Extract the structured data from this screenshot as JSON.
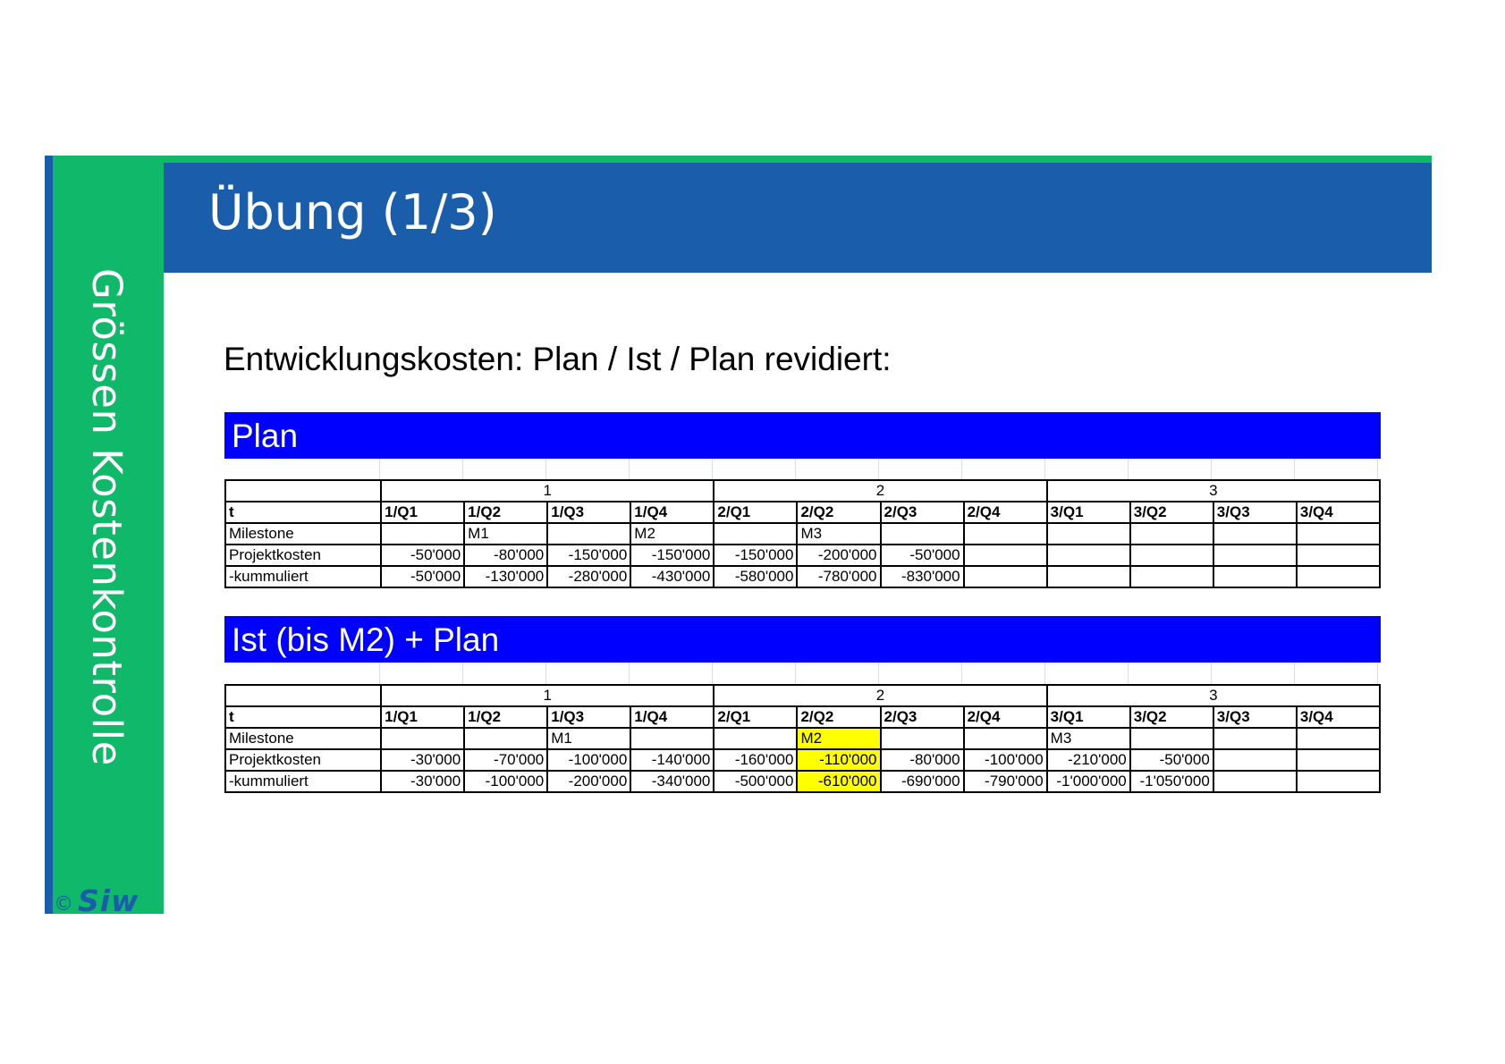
{
  "sidebar": {
    "title": "Grössen Kostenkontrolle",
    "copyright": "©",
    "logo": "Siw"
  },
  "header": {
    "title": "Übung (1/3)"
  },
  "subtitle": "Entwicklungskosten: Plan / Ist / Plan revidiert:",
  "colors": {
    "green": "#10b86a",
    "blue": "#1a5dab",
    "section": "#0000ff",
    "highlight": "#ffff00"
  },
  "tables": [
    {
      "section_label": "Plan",
      "years": [
        "1",
        "2",
        "3"
      ],
      "header": [
        "t",
        "1/Q1",
        "1/Q2",
        "1/Q3",
        "1/Q4",
        "2/Q1",
        "2/Q2",
        "2/Q3",
        "2/Q4",
        "3/Q1",
        "3/Q2",
        "3/Q3",
        "3/Q4"
      ],
      "rows": [
        [
          "Milestone",
          "",
          "M1",
          "",
          "M2",
          "",
          "M3",
          "",
          "",
          "",
          "",
          "",
          ""
        ],
        [
          "Projektkosten",
          "-50'000",
          "-80'000",
          "-150'000",
          "-150'000",
          "-150'000",
          "-200'000",
          "-50'000",
          "",
          "",
          "",
          "",
          ""
        ],
        [
          "-kummuliert",
          "-50'000",
          "-130'000",
          "-280'000",
          "-430'000",
          "-580'000",
          "-780'000",
          "-830'000",
          "",
          "",
          "",
          "",
          ""
        ]
      ],
      "highlight_column": null
    },
    {
      "section_label": "Ist (bis M2) + Plan",
      "years": [
        "1",
        "2",
        "3"
      ],
      "header": [
        "t",
        "1/Q1",
        "1/Q2",
        "1/Q3",
        "1/Q4",
        "2/Q1",
        "2/Q2",
        "2/Q3",
        "2/Q4",
        "3/Q1",
        "3/Q2",
        "3/Q3",
        "3/Q4"
      ],
      "rows": [
        [
          "Milestone",
          "",
          "",
          "M1",
          "",
          "",
          "M2",
          "",
          "",
          "M3",
          "",
          "",
          ""
        ],
        [
          "Projektkosten",
          "-30'000",
          "-70'000",
          "-100'000",
          "-140'000",
          "-160'000",
          "-110'000",
          "-80'000",
          "-100'000",
          "-210'000",
          "-50'000",
          "",
          ""
        ],
        [
          "-kummuliert",
          "-30'000",
          "-100'000",
          "-200'000",
          "-340'000",
          "-500'000",
          "-610'000",
          "-690'000",
          "-790'000",
          "-1'000'000",
          "-1'050'000",
          "",
          ""
        ]
      ],
      "highlight_column": 6
    }
  ]
}
